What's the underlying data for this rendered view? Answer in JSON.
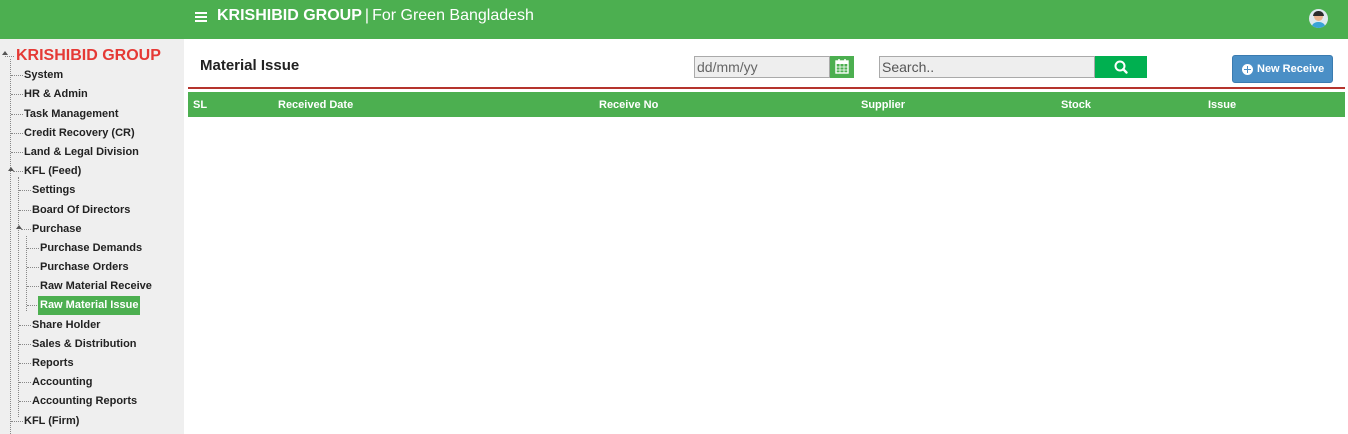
{
  "header": {
    "brand": "KRISHIBID GROUP",
    "separator": "|",
    "tagline": "For Green Bangladesh",
    "colors": {
      "bar": "#4caf50"
    }
  },
  "sidebar": {
    "root_title": "KRISHIBID GROUP",
    "items": {
      "system": "System",
      "hr_admin": "HR & Admin",
      "task_management": "Task Management",
      "credit_recovery": "Credit Recovery (CR)",
      "land_legal": "Land & Legal Division",
      "kfl_feed": "KFL (Feed)",
      "settings": "Settings",
      "board_of_directors": "Board Of Directors",
      "purchase": "Purchase",
      "purchase_demands": "Purchase Demands",
      "purchase_orders": "Purchase Orders",
      "raw_material_receive": "Raw Material Receive",
      "raw_material_issue": "Raw Material Issue",
      "share_holder": "Share Holder",
      "sales_distribution": "Sales & Distribution",
      "reports": "Reports",
      "accounting": "Accounting",
      "accounting_reports": "Accounting Reports",
      "kfl_firm": "KFL (Firm)"
    },
    "active": "Raw Material Issue",
    "colors": {
      "active_bg": "#4caf50",
      "root_title": "#e53935"
    }
  },
  "main": {
    "title": "Material Issue",
    "date_placeholder": "dd/mm/yy",
    "search_placeholder": "Search..",
    "new_button": "New Receive",
    "table": {
      "columns": [
        "SL",
        "Received Date",
        "Receive No",
        "Supplier",
        "Stock",
        "Issue"
      ],
      "rows": []
    },
    "icons": {
      "date": "calendar-icon",
      "search": "search-icon",
      "new": "plus-circle-icon"
    }
  }
}
